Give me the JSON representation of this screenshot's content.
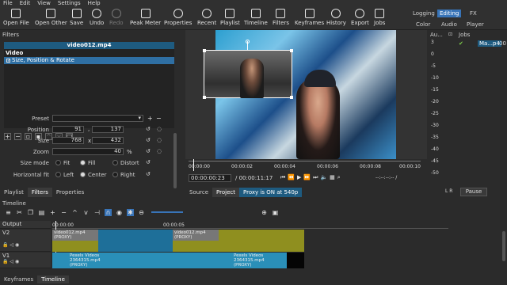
{
  "menu": [
    "File",
    "Edit",
    "View",
    "Settings",
    "Help"
  ],
  "toolbar": {
    "items": [
      {
        "label": "Open File",
        "icon": "folder-open-icon",
        "enabled": true
      },
      {
        "label": "Open Other",
        "icon": "open-other-icon",
        "enabled": true
      },
      {
        "label": "Save",
        "icon": "save-icon",
        "enabled": true
      },
      {
        "label": "Undo",
        "icon": "undo-icon",
        "enabled": true
      },
      {
        "label": "Redo",
        "icon": "redo-icon",
        "enabled": false
      },
      {
        "label": "Peak Meter",
        "icon": "peak-meter-icon",
        "enabled": true
      },
      {
        "label": "Properties",
        "icon": "properties-icon",
        "enabled": true
      },
      {
        "label": "Recent",
        "icon": "recent-icon",
        "enabled": true
      },
      {
        "label": "Playlist",
        "icon": "playlist-icon",
        "enabled": true
      },
      {
        "label": "Timeline",
        "icon": "timeline-icon",
        "enabled": true
      },
      {
        "label": "Filters",
        "icon": "filters-icon",
        "enabled": true
      },
      {
        "label": "Keyframes",
        "icon": "keyframes-icon",
        "enabled": true
      },
      {
        "label": "History",
        "icon": "history-icon",
        "enabled": true
      },
      {
        "label": "Export",
        "icon": "export-icon",
        "enabled": true
      },
      {
        "label": "Jobs",
        "icon": "jobs-icon",
        "enabled": true
      }
    ],
    "layouts_row1": [
      "Logging",
      "Editing",
      "FX"
    ],
    "layouts_row2": [
      "Color",
      "Audio",
      "Player"
    ],
    "active_layout": "Editing"
  },
  "filters": {
    "title": "Filters",
    "clip_name": "video012.mp4",
    "category": "Video",
    "items": [
      {
        "label": "Size, Position & Rotate",
        "checked": true
      }
    ],
    "preset_label": "Preset",
    "position_label": "Position",
    "position_x": "91",
    "position_sep": ",",
    "position_y": "137",
    "size_label": "Size",
    "size_w": "768",
    "size_x": "x",
    "size_h": "432",
    "zoom_label": "Zoom",
    "zoom_value": "40",
    "zoom_unit": "%",
    "size_mode_label": "Size mode",
    "size_mode_options": [
      "Fit",
      "Fill",
      "Distort"
    ],
    "size_mode_selected": "Fill",
    "hfit_label": "Horizontal fit",
    "hfit_options": [
      "Left",
      "Center",
      "Right"
    ],
    "hfit_selected": "Center"
  },
  "left_tabs": [
    "Playlist",
    "Filters",
    "Properties"
  ],
  "left_tabs_active": "Filters",
  "viewer": {
    "ruler_labels": [
      "00:00:00",
      "00:00:02",
      "00:00:04",
      "00:00:06",
      "00:00:08",
      "00:00:10"
    ],
    "current_time": "00:00:00:23",
    "duration": "/ 00:00:11:17",
    "in_out": "--:--:--:-- /",
    "tabs": [
      "Source",
      "Project"
    ],
    "proxy_label": "Proxy is ON at 540p"
  },
  "meter": {
    "title": "Au...",
    "scale": [
      "3",
      "0",
      "-5",
      "-10",
      "-15",
      "-20",
      "-25",
      "-30",
      "-35",
      "-40",
      "-45",
      "-50"
    ],
    "channels": "L  R"
  },
  "jobs": {
    "title": "Jobs",
    "item_label": "Ma...p4",
    "item_status": "00",
    "pause_label": "Pause"
  },
  "timeline": {
    "title": "Timeline",
    "ruler": [
      "00:00:00",
      "00:00:05"
    ],
    "tracks": [
      {
        "name": "Output"
      },
      {
        "name": "V2",
        "clips": [
          {
            "name": "video012.mp4",
            "tag": "(PROXY)"
          },
          {
            "name": "video012.mp4",
            "tag": "(PROXY)"
          }
        ]
      },
      {
        "name": "V1",
        "clips": [
          {
            "name": "Pexels Videos 2364315.mp4",
            "tag": "(PROXY)"
          },
          {
            "name": "Pexels Videos 2364315.mp4",
            "tag": "(PROXY)"
          }
        ]
      }
    ]
  },
  "bottom_tabs": [
    "Keyframes",
    "Timeline"
  ],
  "bottom_tabs_active": "Timeline",
  "colors": {
    "accent": "#3874b8",
    "v2_track": "#8f8f1f",
    "v1_clip": "#2a8fb8",
    "selection": "#1e5b80"
  }
}
